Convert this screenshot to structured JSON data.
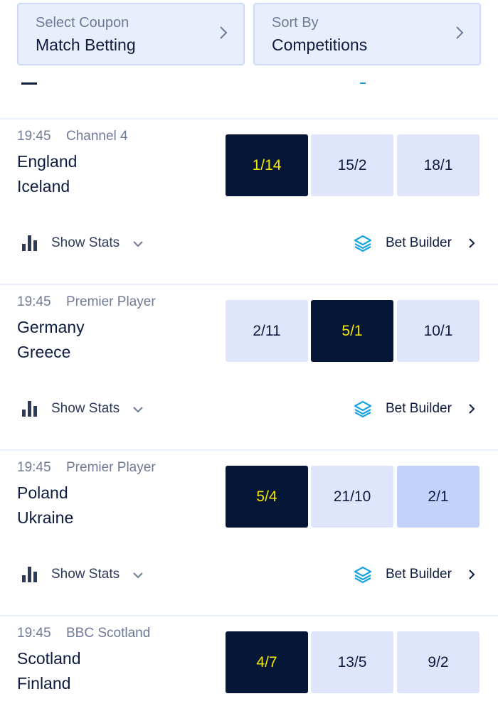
{
  "header": {
    "coupon": {
      "label": "Select Coupon",
      "value": "Match Betting"
    },
    "sort": {
      "label": "Sort By",
      "value": "Competitions"
    }
  },
  "colors": {
    "selected_bg": "#051637",
    "selected_text": "#f3e600",
    "odds_bg": "#dfe6fb",
    "odds_highlight_bg": "#c2d2fb",
    "accent_blue": "#1aa3e0"
  },
  "events": [
    {
      "time": "19:45",
      "channel": "Channel 4",
      "home": "England",
      "away": "Iceland",
      "odds": [
        {
          "value": "1/14",
          "state": "selected"
        },
        {
          "value": "15/2",
          "state": "normal"
        },
        {
          "value": "18/1",
          "state": "normal"
        }
      ],
      "stats_label": "Show Stats",
      "bet_builder_label": "Bet Builder"
    },
    {
      "time": "19:45",
      "channel": "Premier Player",
      "home": "Germany",
      "away": "Greece",
      "odds": [
        {
          "value": "2/11",
          "state": "normal"
        },
        {
          "value": "5/1",
          "state": "selected"
        },
        {
          "value": "10/1",
          "state": "normal"
        }
      ],
      "stats_label": "Show Stats",
      "bet_builder_label": "Bet Builder"
    },
    {
      "time": "19:45",
      "channel": "Premier Player",
      "home": "Poland",
      "away": "Ukraine",
      "odds": [
        {
          "value": "5/4",
          "state": "selected"
        },
        {
          "value": "21/10",
          "state": "normal"
        },
        {
          "value": "2/1",
          "state": "highlighted"
        }
      ],
      "stats_label": "Show Stats",
      "bet_builder_label": "Bet Builder"
    },
    {
      "time": "19:45",
      "channel": "BBC Scotland",
      "home": "Scotland",
      "away": "Finland",
      "odds": [
        {
          "value": "4/7",
          "state": "selected"
        },
        {
          "value": "13/5",
          "state": "normal"
        },
        {
          "value": "9/2",
          "state": "normal"
        }
      ]
    }
  ],
  "icons": {
    "stats": "bar-chart-icon",
    "bet_builder": "layers-icon",
    "chevron_right": "chevron-right-icon",
    "chevron_down": "chevron-down-icon"
  }
}
